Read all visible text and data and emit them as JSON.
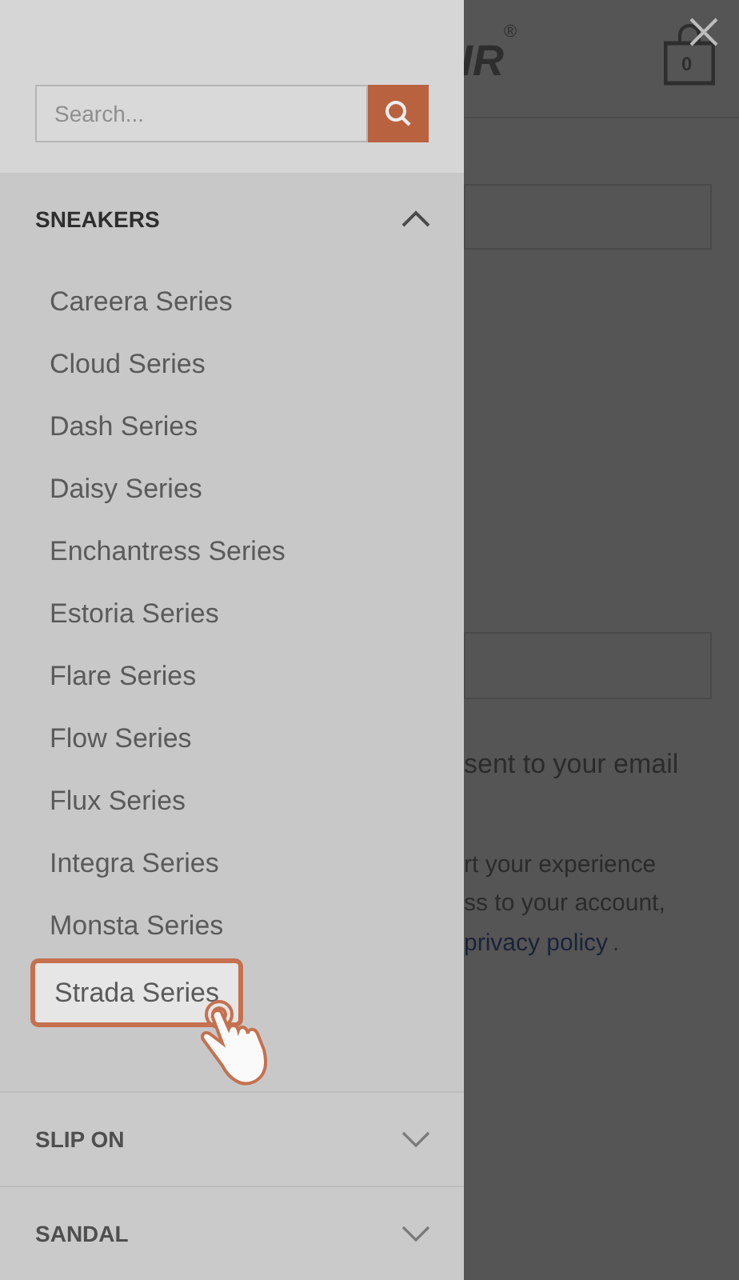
{
  "search": {
    "placeholder": "Search..."
  },
  "categories": [
    {
      "label": "SNEAKERS",
      "expanded": true,
      "items": [
        {
          "label": "Careera Series",
          "selected": false
        },
        {
          "label": "Cloud Series",
          "selected": false
        },
        {
          "label": "Dash Series",
          "selected": false
        },
        {
          "label": "Daisy Series",
          "selected": false
        },
        {
          "label": "Enchantress Series",
          "selected": false
        },
        {
          "label": "Estoria Series",
          "selected": false
        },
        {
          "label": "Flare Series",
          "selected": false
        },
        {
          "label": "Flow Series",
          "selected": false
        },
        {
          "label": "Flux Series",
          "selected": false
        },
        {
          "label": "Integra Series",
          "selected": false
        },
        {
          "label": "Monsta Series",
          "selected": false
        },
        {
          "label": "Strada Series",
          "selected": true
        }
      ]
    },
    {
      "label": "SLIP ON",
      "expanded": false
    },
    {
      "label": "SANDAL",
      "expanded": false
    }
  ],
  "page": {
    "logo": "IR",
    "logo_mark": "®",
    "cart_count": "0",
    "lines": [
      "sent to your email",
      "rt your experience",
      "ss to your account,"
    ],
    "link": "privacy policy",
    "link_suffix": "."
  }
}
